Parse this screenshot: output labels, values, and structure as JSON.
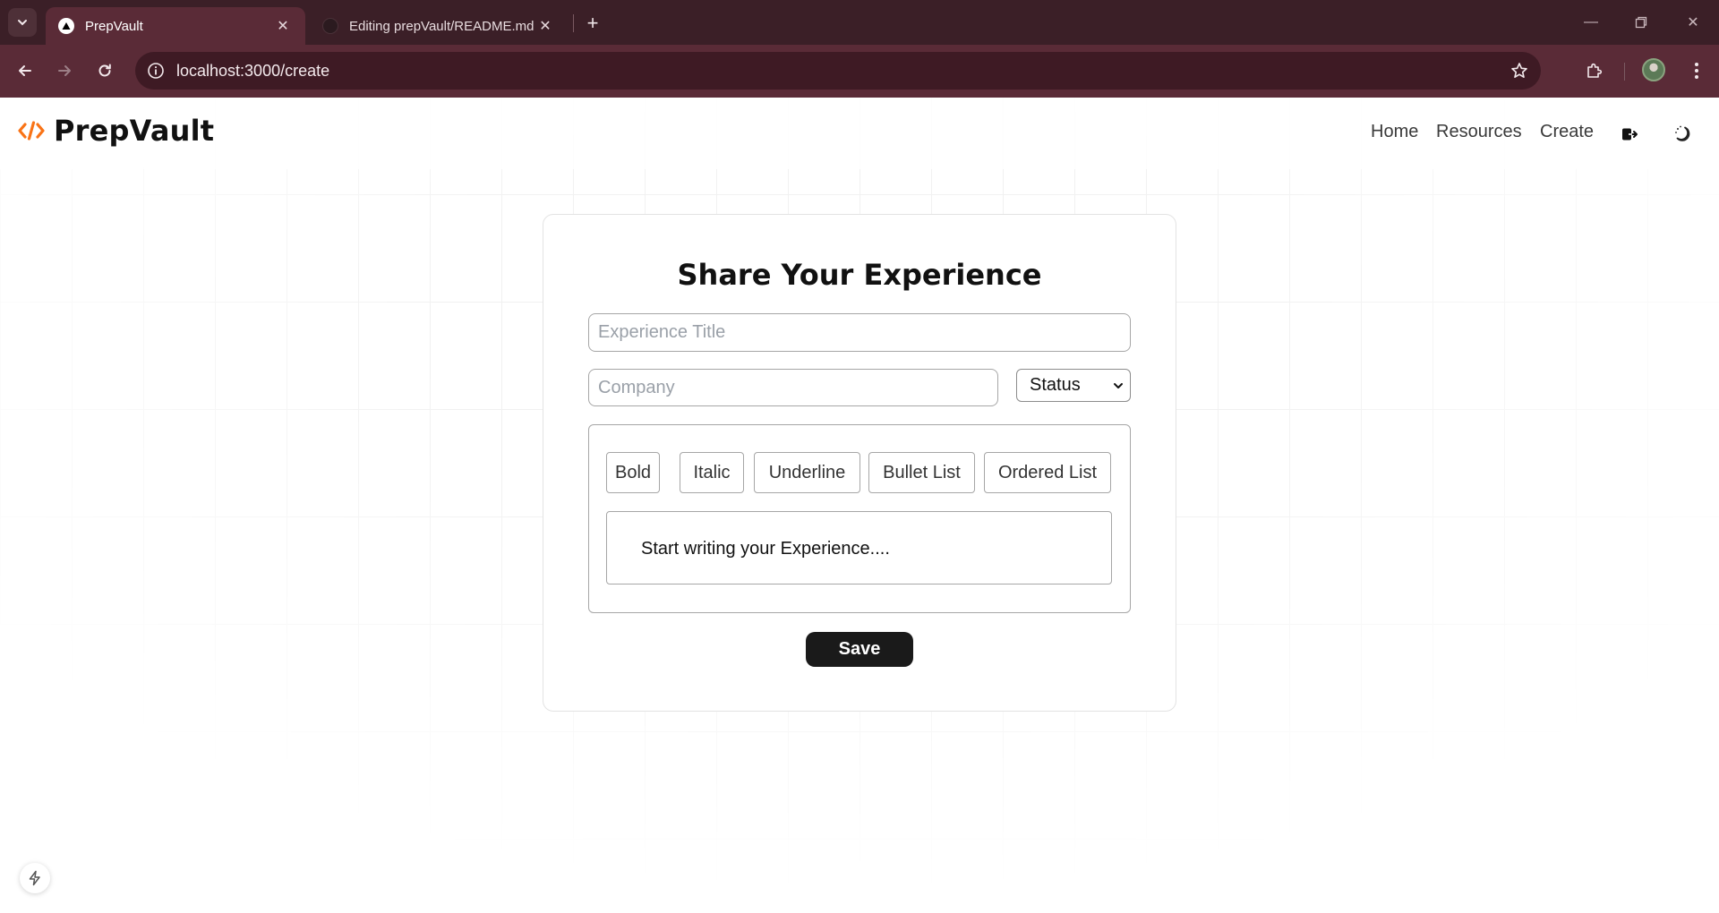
{
  "browser": {
    "tabs": [
      {
        "title": "PrepVault",
        "active": true
      },
      {
        "title": "Editing prepVault/README.md",
        "active": false
      }
    ],
    "url": "localhost:3000/create",
    "colors": {
      "frame": "#3b1f27",
      "toolbar": "#5a2b37",
      "omnibox": "#3e1a24"
    }
  },
  "header": {
    "brand": "PrepVault",
    "brand_icon": "code-icon",
    "nav": {
      "home": "Home",
      "resources": "Resources",
      "create": "Create"
    },
    "accent": "#f97316"
  },
  "form": {
    "heading": "Share Your Experience",
    "title_placeholder": "Experience Title",
    "title_value": "",
    "company_placeholder": "Company",
    "company_value": "",
    "status_selected": "Status",
    "toolbar": {
      "bold": "Bold",
      "italic": "Italic",
      "underline": "Underline",
      "bullet_list": "Bullet List",
      "ordered_list": "Ordered List"
    },
    "editor_placeholder": "Start writing your Experience....",
    "save_label": "Save"
  }
}
